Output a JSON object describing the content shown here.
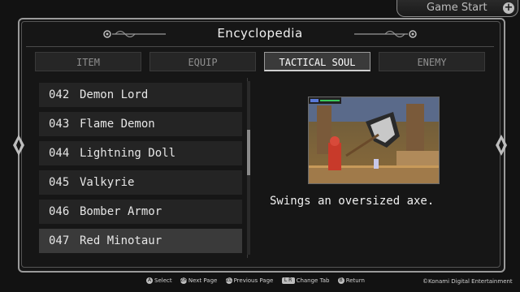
{
  "game_start": {
    "label": "Game Start",
    "icon": "plus-button-icon"
  },
  "header": {
    "title": "Encyclopedia"
  },
  "tabs": [
    {
      "label": "ITEM",
      "active": false
    },
    {
      "label": "EQUIP",
      "active": false
    },
    {
      "label": "TACTICAL SOUL",
      "active": true
    },
    {
      "label": "ENEMY",
      "active": false
    }
  ],
  "list": {
    "items": [
      {
        "number": "042",
        "name": "Demon Lord"
      },
      {
        "number": "043",
        "name": "Flame Demon"
      },
      {
        "number": "044",
        "name": "Lightning Doll"
      },
      {
        "number": "045",
        "name": "Valkyrie"
      },
      {
        "number": "046",
        "name": "Bomber Armor"
      },
      {
        "number": "047",
        "name": "Red Minotaur"
      }
    ],
    "selected_index": 5
  },
  "detail": {
    "description": "Swings an oversized axe."
  },
  "footer": {
    "hints": [
      {
        "button": "A",
        "label": "Select"
      },
      {
        "button": "ZR",
        "label": "Next Page"
      },
      {
        "button": "ZL",
        "label": "Previous Page"
      },
      {
        "button": "L R",
        "label": "Change Tab"
      },
      {
        "button": "B",
        "label": "Return"
      }
    ],
    "copyright": "©Konami Digital Entertainment"
  },
  "colors": {
    "background": "#121212",
    "frame_border": "#9a9a9a",
    "row": "#242424",
    "row_selected": "#3a3a3a",
    "text": "#e8e8e8"
  }
}
